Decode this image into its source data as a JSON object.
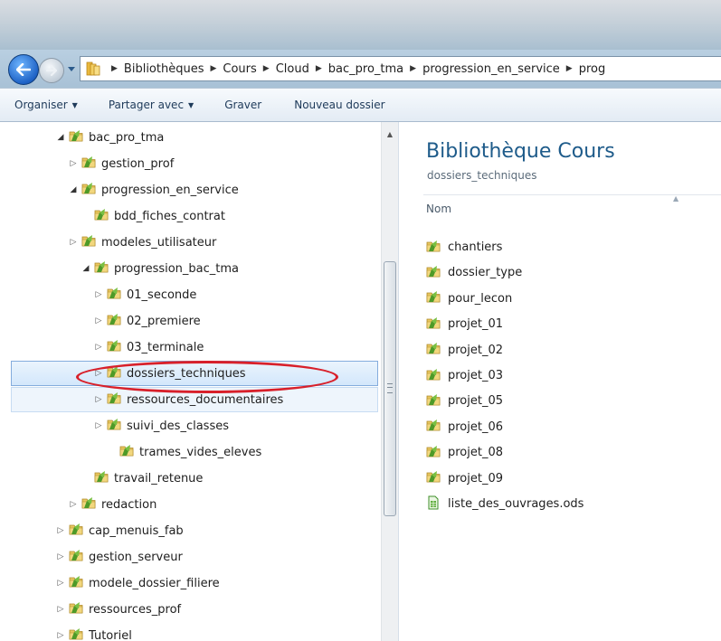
{
  "breadcrumb": [
    "Bibliothèques",
    "Cours",
    "Cloud",
    "bac_pro_tma",
    "progression_en_service",
    "prog"
  ],
  "toolbar": {
    "organize": "Organiser",
    "share": "Partager avec",
    "burn": "Graver",
    "new_folder": "Nouveau dossier"
  },
  "tree": [
    {
      "label": "bac_pro_tma",
      "level": 3,
      "state": "open"
    },
    {
      "label": "gestion_prof",
      "level": 4,
      "state": "closed"
    },
    {
      "label": "progression_en_service",
      "level": 4,
      "state": "open"
    },
    {
      "label": "bdd_fiches_contrat",
      "level": 5,
      "state": "none"
    },
    {
      "label": "modeles_utilisateur",
      "level": 4,
      "state": "closed"
    },
    {
      "label": "progression_bac_tma",
      "level": 5,
      "state": "open"
    },
    {
      "label": "01_seconde",
      "level": 6,
      "state": "closed"
    },
    {
      "label": "02_premiere",
      "level": 6,
      "state": "closed"
    },
    {
      "label": "03_terminale",
      "level": 6,
      "state": "closed"
    },
    {
      "label": "dossiers_techniques",
      "level": 6,
      "state": "closed",
      "selected": true
    },
    {
      "label": "ressources_documentaires",
      "level": 6,
      "state": "closed",
      "hover": true
    },
    {
      "label": "suivi_des_classes",
      "level": 6,
      "state": "closed"
    },
    {
      "label": "trames_vides_eleves",
      "level": 7,
      "state": "none"
    },
    {
      "label": "travail_retenue",
      "level": 5,
      "state": "none"
    },
    {
      "label": "redaction",
      "level": 4,
      "state": "closed"
    },
    {
      "label": "cap_menuis_fab",
      "level": 3,
      "state": "closed"
    },
    {
      "label": "gestion_serveur",
      "level": 3,
      "state": "closed"
    },
    {
      "label": "modele_dossier_filiere",
      "level": 3,
      "state": "closed"
    },
    {
      "label": "ressources_prof",
      "level": 3,
      "state": "closed"
    },
    {
      "label": "Tutoriel",
      "level": 3,
      "state": "closed"
    }
  ],
  "content": {
    "title": "Bibliothèque Cours",
    "subtitle": "dossiers_techniques",
    "column_name": "Nom",
    "items": [
      {
        "name": "chantiers",
        "type": "folder"
      },
      {
        "name": "dossier_type",
        "type": "folder"
      },
      {
        "name": "pour_lecon",
        "type": "folder"
      },
      {
        "name": "projet_01",
        "type": "folder"
      },
      {
        "name": "projet_02",
        "type": "folder"
      },
      {
        "name": "projet_03",
        "type": "folder"
      },
      {
        "name": "projet_05",
        "type": "folder"
      },
      {
        "name": "projet_06",
        "type": "folder"
      },
      {
        "name": "projet_08",
        "type": "folder"
      },
      {
        "name": "projet_09",
        "type": "folder"
      },
      {
        "name": "liste_des_ouvrages.ods",
        "type": "spreadsheet"
      }
    ]
  },
  "colors": {
    "accent": "#1e5b8a",
    "selection": "#d3e7fb",
    "highlight_ring": "#d8202a"
  }
}
